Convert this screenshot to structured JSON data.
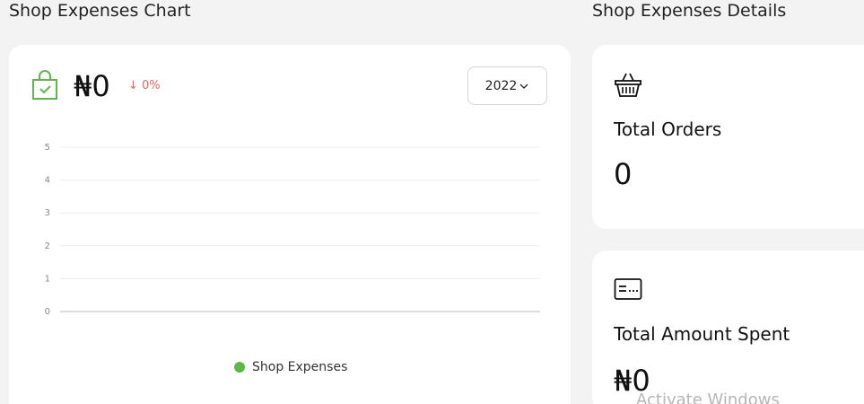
{
  "section_titles": {
    "chart": "Shop Expenses Chart",
    "details": "Shop Expenses Details"
  },
  "chart_card": {
    "amount": "₦0",
    "change": "↓ 0%",
    "year_select": {
      "selected": "2022"
    },
    "icon": "shopping-bag-check-icon",
    "colors": {
      "accent": "#5cb947",
      "change_negative": "#e46a63"
    }
  },
  "chart_data": {
    "type": "line",
    "title": "",
    "xlabel": "",
    "ylabel": "",
    "y_ticks": [
      "0",
      "1",
      "2",
      "3",
      "4",
      "5"
    ],
    "ylim": [
      0,
      5
    ],
    "grid": true,
    "series": [
      {
        "name": "Shop Expenses",
        "values": [],
        "color": "#5cb947"
      }
    ],
    "legend_position": "bottom-center"
  },
  "details": {
    "total_orders": {
      "label": "Total Orders",
      "value": "0",
      "icon": "shopping-basket-icon"
    },
    "total_amount_spent": {
      "label": "Total Amount Spent",
      "value": "₦0",
      "icon": "credit-card-icon"
    }
  },
  "watermark": "Activate Windows"
}
